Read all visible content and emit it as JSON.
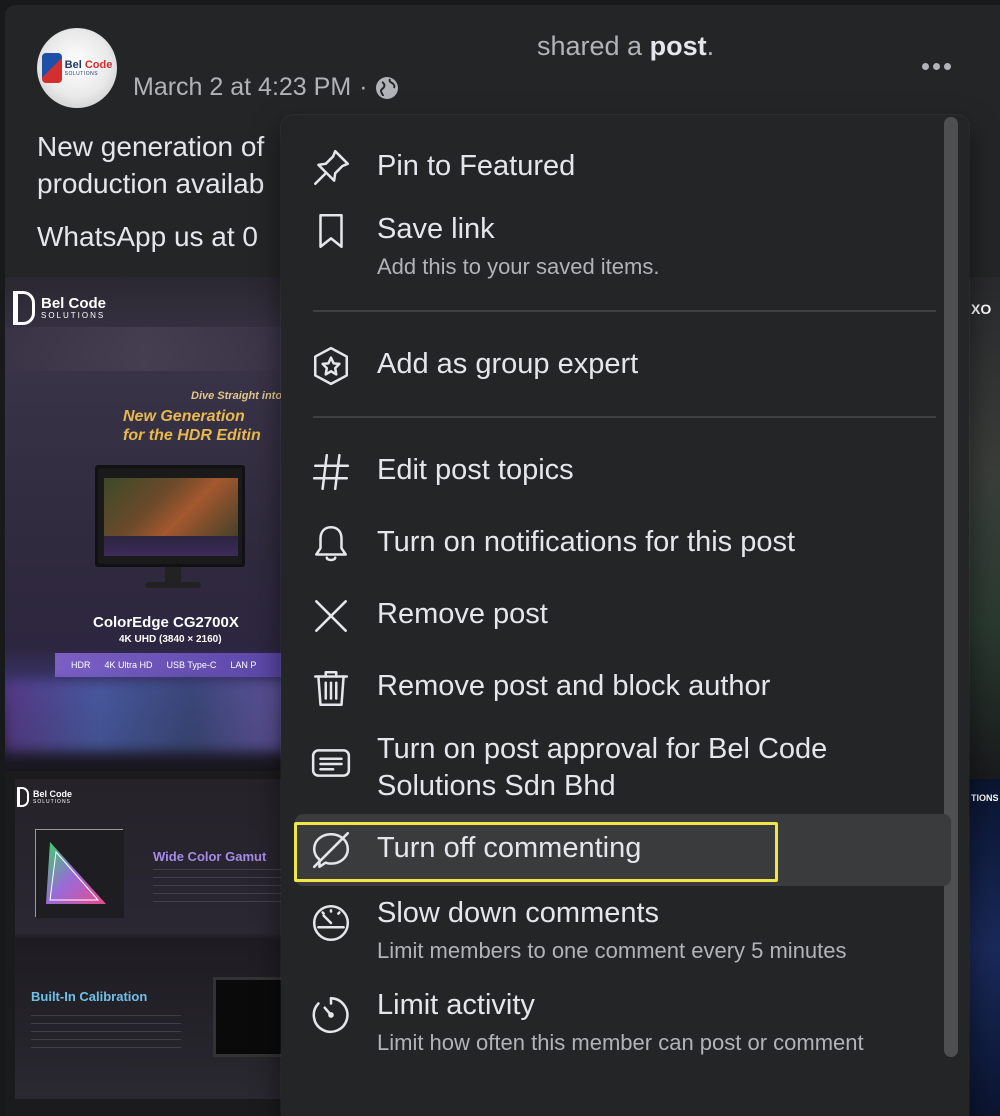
{
  "post": {
    "shared_text_prefix": "shared a",
    "shared_text_bold": "post",
    "shared_text_suffix": ".",
    "timestamp": "March 2 at 4:23 PM",
    "separator": "·",
    "audience_icon": "globe-icon",
    "avatar_logo": {
      "brand": "Bel Code",
      "brand_red": "Code",
      "sub": "SOLUTIONS"
    },
    "body_line1": "New generation of",
    "body_line2": "production availab",
    "body_line3": "WhatsApp us at 0",
    "more_icon": "more-horizontal-icon"
  },
  "media": {
    "main": {
      "brand": "Bel Code",
      "brand_sub": "SOLUTIONS",
      "tagline": "Dive Straight into You",
      "headline1": "New Generation",
      "headline2": "for the HDR Editin",
      "model": "ColorEdge CG2700X",
      "model_sub": "4K UHD (3840 × 2160)",
      "specs": [
        "HDR",
        "4K Ultra HD",
        "USB Type-C",
        "LAN P"
      ]
    },
    "second": {
      "brand": "Bel Code",
      "brand_sub": "SOLUTIONS",
      "feature1": "Wide Color Gamut",
      "feature2": "Built-In Calibration"
    },
    "right_top_text": "XO",
    "right_bottom_text": "TIONS"
  },
  "menu": {
    "items": [
      {
        "icon": "pin-icon",
        "label": "Pin to Featured",
        "desc": ""
      },
      {
        "icon": "bookmark-icon",
        "label": "Save link",
        "desc": "Add this to your saved items."
      },
      {
        "icon": "star-badge-icon",
        "label": "Add as group expert",
        "desc": ""
      },
      {
        "icon": "hashtag-icon",
        "label": "Edit post topics",
        "desc": ""
      },
      {
        "icon": "bell-icon",
        "label": "Turn on notifications for this post",
        "desc": ""
      },
      {
        "icon": "close-icon",
        "label": "Remove post",
        "desc": ""
      },
      {
        "icon": "trash-icon",
        "label": "Remove post and block author",
        "desc": ""
      },
      {
        "icon": "post-approval-icon",
        "label": "Turn on post approval for Bel Code Solutions Sdn Bhd",
        "desc": ""
      },
      {
        "icon": "comment-off-icon",
        "label": "Turn off commenting",
        "desc": ""
      },
      {
        "icon": "speedometer-icon",
        "label": "Slow down comments",
        "desc": "Limit members to one comment every 5 minutes"
      },
      {
        "icon": "timer-icon",
        "label": "Limit activity",
        "desc": "Limit how often this member can post or comment"
      }
    ],
    "highlight_color": "#f0e64a"
  }
}
